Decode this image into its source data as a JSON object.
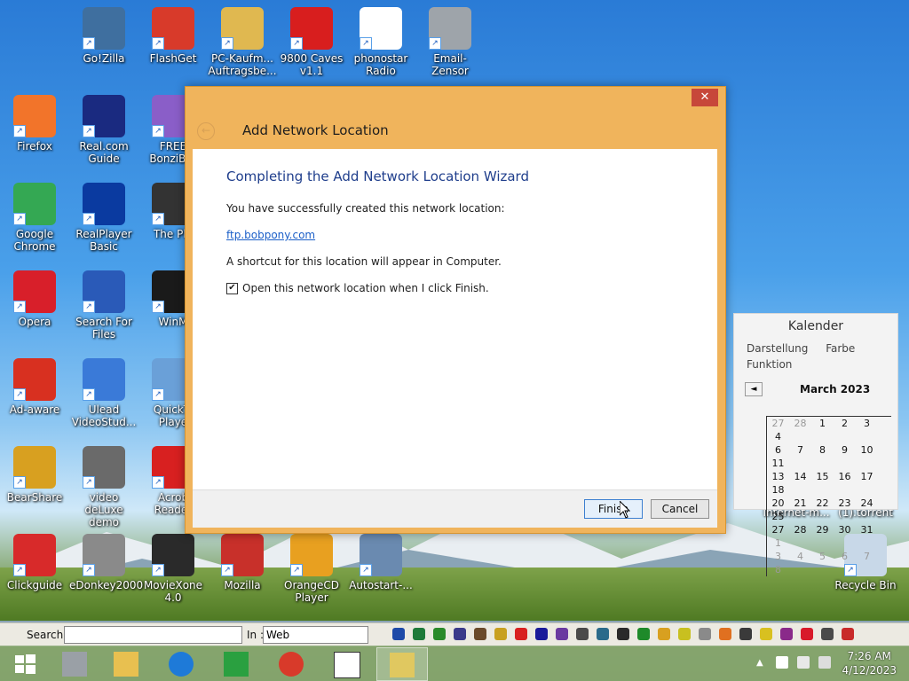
{
  "desktop": {
    "icons": [
      {
        "label": "Go!Zilla",
        "color": "#3f6f9f"
      },
      {
        "label": "FlashGet",
        "color": "#d83a2a"
      },
      {
        "label": "PC-Kaufm... Auftragsbe...",
        "color": "#e0b850"
      },
      {
        "label": "9800 Caves v1.1",
        "color": "#d81e1e"
      },
      {
        "label": "phonostar Radio",
        "color": "#ffffff"
      },
      {
        "label": "Email-Zensor",
        "color": "#9ea4aa"
      },
      {
        "label": "Firefox",
        "color": "#f2742a"
      },
      {
        "label": "Real.com Guide",
        "color": "#1a2a80"
      },
      {
        "label": "FREE BonziBUI",
        "color": "#8a5ec8"
      },
      {
        "label": "Google Chrome",
        "color": "#34a853"
      },
      {
        "label": "RealPlayer Basic",
        "color": "#0a3aa0"
      },
      {
        "label": "The Pla",
        "color": "#333333"
      },
      {
        "label": "Opera",
        "color": "#d81f2a"
      },
      {
        "label": "Search For Files",
        "color": "#2a5ab8"
      },
      {
        "label": "WinM",
        "color": "#1a1a1a"
      },
      {
        "label": "Ad-aware",
        "color": "#d83020"
      },
      {
        "label": "Ulead VideoStud...",
        "color": "#3a7ad8"
      },
      {
        "label": "QuickTi Playe",
        "color": "#6aa0d8"
      },
      {
        "label": "BearShare",
        "color": "#d8a020"
      },
      {
        "label": "video deLuxe demo",
        "color": "#6a6a6a"
      },
      {
        "label": "Acrob Reader",
        "color": "#d82020"
      },
      {
        "label": "Clickguide",
        "color": "#d82a2a"
      },
      {
        "label": "eDonkey2000",
        "color": "#8a8a8a"
      },
      {
        "label": "MovieXone 4.0",
        "color": "#2a2a2a"
      },
      {
        "label": "Mozilla",
        "color": "#c8302a"
      },
      {
        "label": "OrangeCD Player",
        "color": "#e8a020"
      },
      {
        "label": "Autostart-...",
        "color": "#6a8ab0"
      },
      {
        "label": "Internet-m...",
        "color": "#d82020"
      },
      {
        "label": "(1).torrent",
        "color": "#6a6a6a"
      },
      {
        "label": "Recycle Bin",
        "color": "#c8d8e8"
      }
    ]
  },
  "dialog": {
    "title": "Add Network Location",
    "close": "✕",
    "back": "←",
    "heading": "Completing the Add Network Location Wizard",
    "line1": "You have successfully created this network location:",
    "link": "ftp.bobpony.com",
    "line2": "A shortcut for this location will appear in Computer.",
    "checkbox_label": "Open this network location when I click Finish.",
    "checkbox_mark": "✔",
    "finish": "Finish",
    "cancel": "Cancel"
  },
  "calendar": {
    "title": "Kalender",
    "menu": [
      "Darstellung",
      "Farbe",
      "Funktion"
    ],
    "prev": "◄",
    "month": "March 2023",
    "weeks": [
      [
        {
          "d": "27",
          "m": true
        },
        {
          "d": "28",
          "m": true
        },
        {
          "d": "1"
        },
        {
          "d": "2"
        },
        {
          "d": "3"
        },
        {
          "d": "4"
        }
      ],
      [
        {
          "d": "6"
        },
        {
          "d": "7"
        },
        {
          "d": "8"
        },
        {
          "d": "9"
        },
        {
          "d": "10"
        },
        {
          "d": "11"
        }
      ],
      [
        {
          "d": "13"
        },
        {
          "d": "14"
        },
        {
          "d": "15"
        },
        {
          "d": "16"
        },
        {
          "d": "17"
        },
        {
          "d": "18"
        }
      ],
      [
        {
          "d": "20"
        },
        {
          "d": "21"
        },
        {
          "d": "22"
        },
        {
          "d": "23"
        },
        {
          "d": "24"
        },
        {
          "d": "25"
        }
      ],
      [
        {
          "d": "27"
        },
        {
          "d": "28"
        },
        {
          "d": "29"
        },
        {
          "d": "30"
        },
        {
          "d": "31"
        },
        {
          "d": "1",
          "m": true
        }
      ],
      [
        {
          "d": "3",
          "m": true
        },
        {
          "d": "4",
          "m": true
        },
        {
          "d": "5",
          "m": true
        },
        {
          "d": "6",
          "m": true
        },
        {
          "d": "7",
          "m": true
        },
        {
          "d": "8",
          "m": true
        }
      ]
    ]
  },
  "searchbar": {
    "search_label": "Search :",
    "search_value": "",
    "in_label": "In :",
    "in_value": "Web"
  },
  "taskbar": {
    "time": "7:26 AM",
    "date": "4/12/2023"
  }
}
